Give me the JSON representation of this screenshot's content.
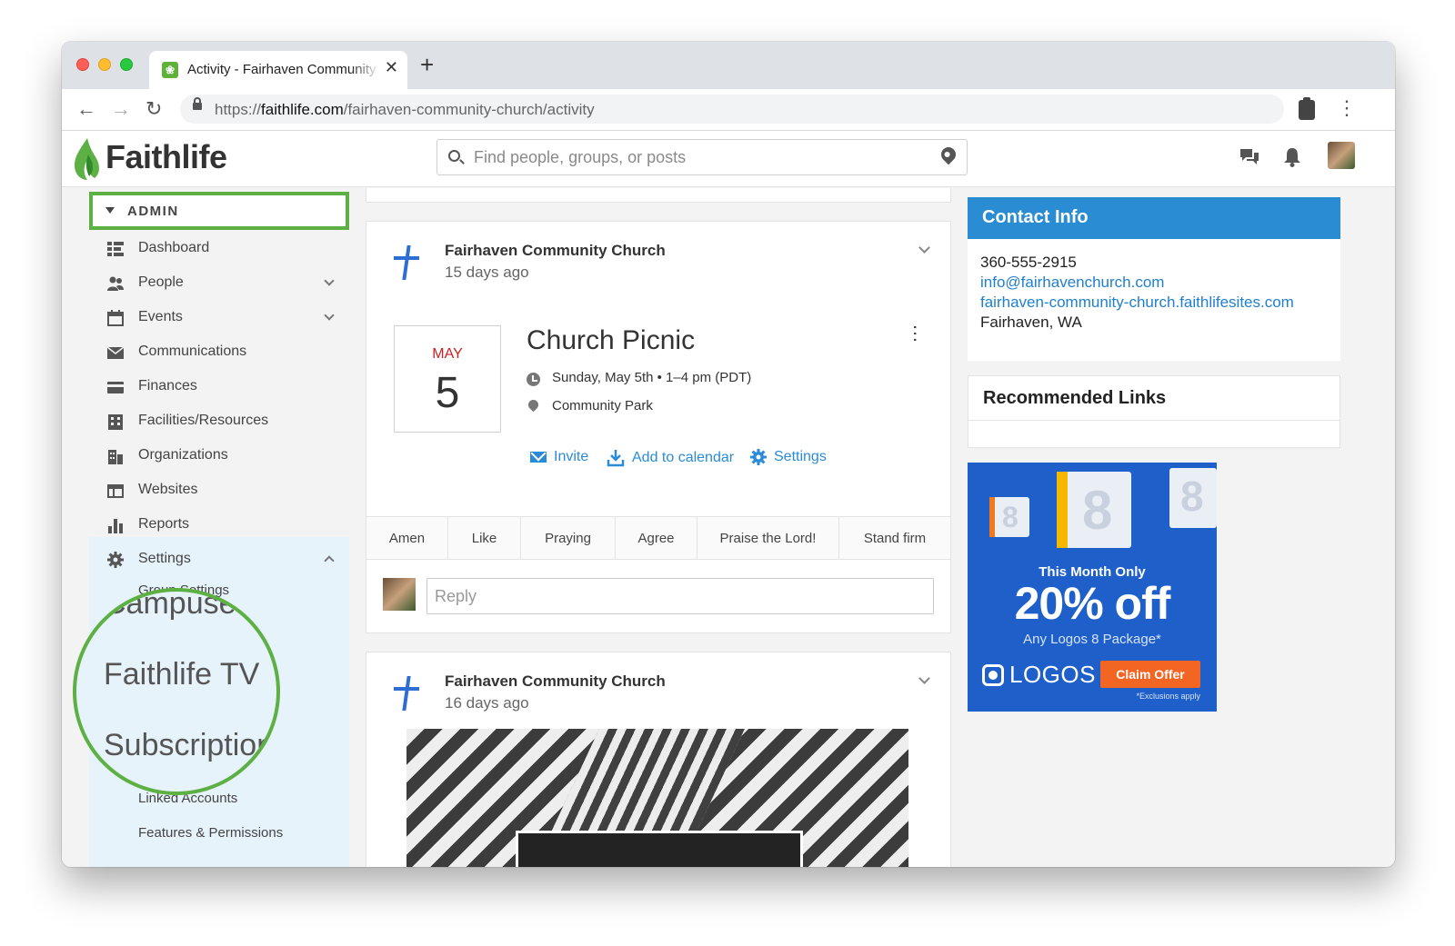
{
  "browser": {
    "tab_title": "Activity - Fairhaven Community Church",
    "url_scheme": "https://",
    "url_host": "faithlife.com",
    "url_path": "/fairhaven-community-church/activity"
  },
  "header": {
    "brand": "Faithlife",
    "search_placeholder": "Find people, groups, or posts"
  },
  "sidebar": {
    "section": "ADMIN",
    "items": [
      {
        "label": "Dashboard",
        "icon": "dashboard-icon"
      },
      {
        "label": "People",
        "icon": "people-icon"
      },
      {
        "label": "Events",
        "icon": "calendar-icon"
      },
      {
        "label": "Communications",
        "icon": "envelope-icon"
      },
      {
        "label": "Finances",
        "icon": "card-icon"
      },
      {
        "label": "Facilities/Resources",
        "icon": "building-icon"
      },
      {
        "label": "Organizations",
        "icon": "organization-icon"
      },
      {
        "label": "Websites",
        "icon": "browser-icon"
      },
      {
        "label": "Reports",
        "icon": "bar-chart-icon"
      },
      {
        "label": "Settings",
        "icon": "gear-icon"
      }
    ],
    "settings_sub": [
      "Group Settings",
      "Linked Accounts",
      "Features & Permissions"
    ],
    "magnified": [
      "Campuses",
      "Faithlife TV",
      "Subscriptions"
    ]
  },
  "feed": {
    "post1": {
      "author": "Fairhaven Community Church",
      "time": "15 days ago",
      "event": {
        "month": "MAY",
        "day": "5",
        "title": "Church Picnic",
        "date": "Sunday, May 5th",
        "time": "1–4 pm (PDT)",
        "location": "Community Park"
      },
      "actions": {
        "invite": "Invite",
        "calendar": "Add to calendar",
        "settings": "Settings"
      },
      "reactions": [
        "Amen",
        "Like",
        "Praying",
        "Agree",
        "Praise the Lord!",
        "Stand firm"
      ],
      "reply_placeholder": "Reply"
    },
    "post2": {
      "author": "Fairhaven Community Church",
      "time": "16 days ago"
    }
  },
  "contact": {
    "title": "Contact Info",
    "phone": "360-555-2915",
    "email": "info@fairhavenchurch.com",
    "website": "fairhaven-community-church.faithlifesites.com",
    "location": "Fairhaven, WA"
  },
  "recommended": {
    "title": "Recommended Links"
  },
  "ad": {
    "kicker": "This Month Only",
    "headline": "20% off",
    "sub": "Any Logos 8 Package*",
    "logo": "LOGOS",
    "cta": "Claim Offer",
    "footnote": "*Exclusions apply",
    "box_label": "8",
    "accent": "#f26522",
    "background": "#1e5fc9"
  },
  "colors": {
    "highlight": "#5db043",
    "link": "#1f7fd0",
    "contact_header": "#2a8dd4"
  }
}
